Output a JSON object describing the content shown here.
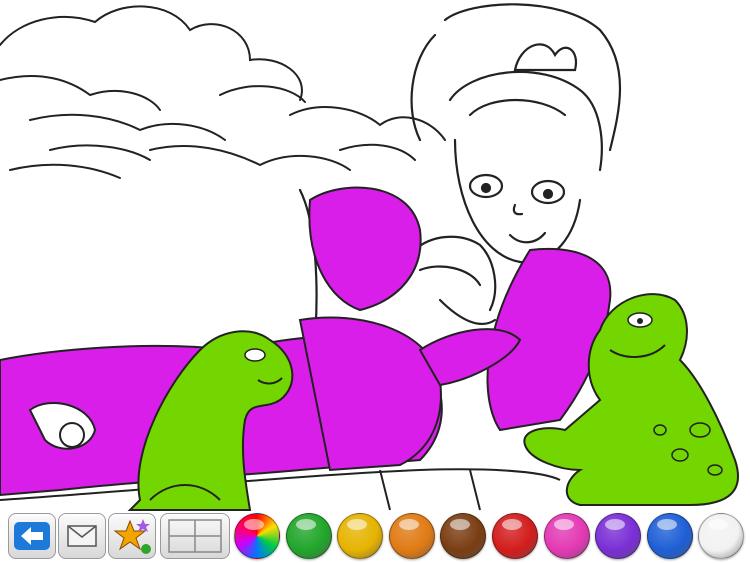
{
  "app": {
    "mode": "coloring",
    "toolbar": {
      "tools": [
        {
          "name": "back-button",
          "icon": "back-arrow-icon"
        },
        {
          "name": "email-button",
          "icon": "envelope-icon"
        },
        {
          "name": "stickers-button",
          "icon": "star-icon"
        },
        {
          "name": "gallery-button",
          "icon": "grid-icon"
        }
      ],
      "palette": [
        {
          "name": "rainbow",
          "color": "#ff00ff"
        },
        {
          "name": "green",
          "color": "#21a52a"
        },
        {
          "name": "yellow",
          "color": "#e6b300"
        },
        {
          "name": "orange",
          "color": "#e07a13"
        },
        {
          "name": "brown",
          "color": "#7a3d12"
        },
        {
          "name": "red",
          "color": "#d31c1c"
        },
        {
          "name": "pink",
          "color": "#e339b4"
        },
        {
          "name": "purple",
          "color": "#7a2ed6"
        },
        {
          "name": "blue",
          "color": "#1e5fd6"
        },
        {
          "name": "white",
          "color": "#f2f2f2"
        }
      ]
    },
    "colors": {
      "princess_dress": "#d81ee8",
      "frog": "#74d600"
    }
  }
}
